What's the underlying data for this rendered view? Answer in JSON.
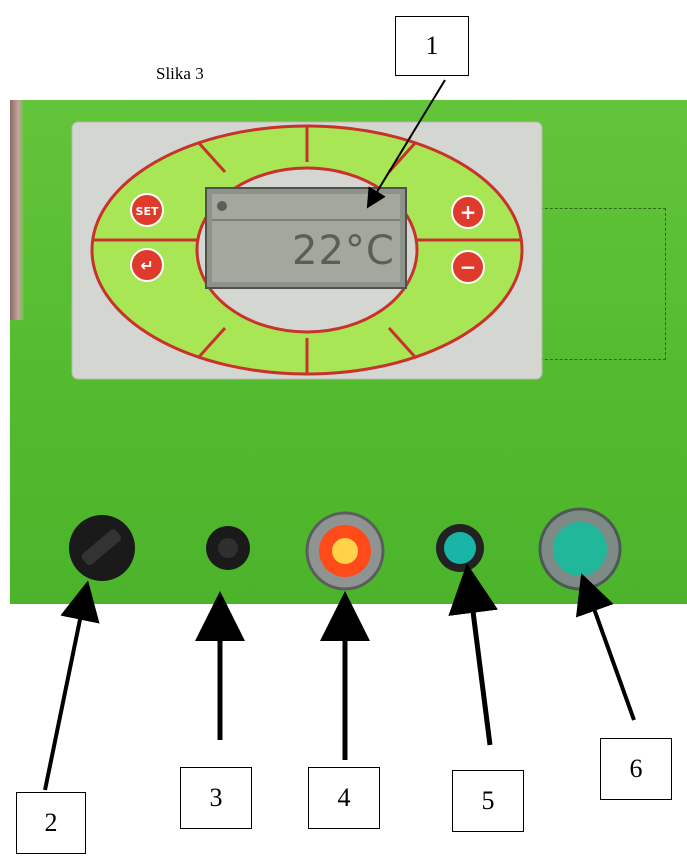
{
  "caption": "Slika 3",
  "display": {
    "temperature": "22°C"
  },
  "buttons": {
    "set": "SET",
    "plus": "+",
    "minus": "−",
    "enter": "↵"
  },
  "labels": [
    "1",
    "2",
    "3",
    "4",
    "5",
    "6"
  ],
  "colors": {
    "panel_green": "#5bbf33",
    "button_green": "#a9e655",
    "outline_red": "#c8322b",
    "lamp_red": "#ff4a1a",
    "lamp_teal": "#19b6a8"
  }
}
